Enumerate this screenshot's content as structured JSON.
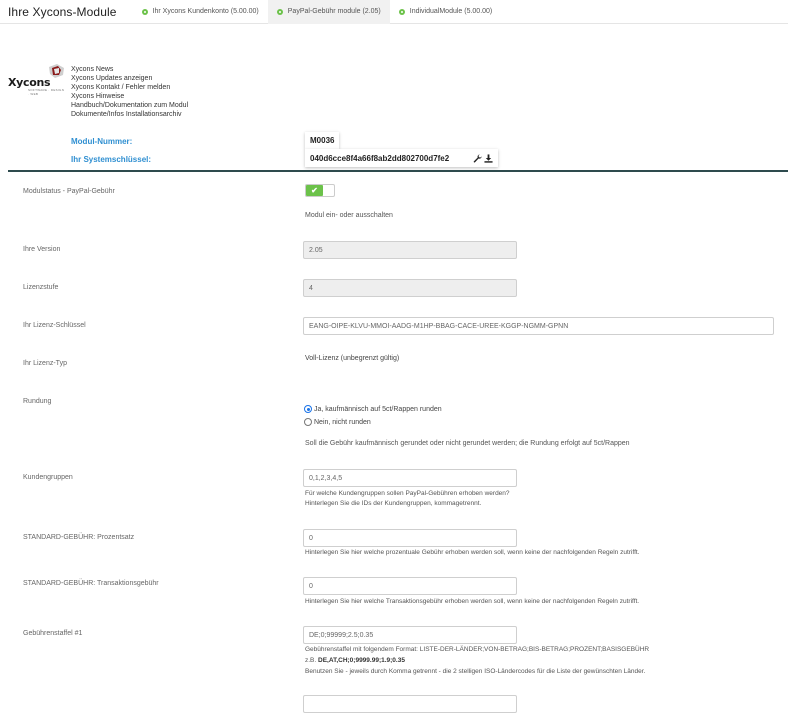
{
  "header": {
    "title": "Ihre Xycons-Module",
    "tabs": [
      {
        "label": "Ihr Xycons Kundenkonto (5.00.00)"
      },
      {
        "label": "PayPal-Gebühr module (2.05)"
      },
      {
        "label": "IndividualModule (5.00.00)"
      }
    ]
  },
  "logo": {
    "text": "Xycons",
    "subtext": "SOFTWARE · DESIGN · WEB"
  },
  "links": [
    "Xycons News",
    "Xycons Updates anzeigen",
    "Xycons Kontakt / Fehler melden",
    "Xycons Hinweise",
    "Handbuch/Dokumentation zum Modul",
    "Dokumente/Infos Installationsarchiv"
  ],
  "module": {
    "number_label": "Modul-Nummer:",
    "number_value": "M0036",
    "syskey_label": "Ihr Systemschlüssel:",
    "syskey_value": "040d6cce8f4a66f8ab2dd802700d7fe2"
  },
  "colors": {
    "accent": "#2f8fd1",
    "toggle_on": "#6cc24a",
    "divider": "#2e4b4e"
  },
  "settings": {
    "status": {
      "label": "Modulstatus - PayPal-Gebühr",
      "help": "Modul ein- oder ausschalten",
      "enabled": true,
      "check_glyph": "✔"
    },
    "version": {
      "label": "Ihre Version",
      "value": "2.05"
    },
    "level": {
      "label": "Lizenzstufe",
      "value": "4"
    },
    "license_key": {
      "label": "Ihr Lizenz-Schlüssel",
      "value": "EANG-OIPE-KLVU-MMOI-AADG-M1HP-BBAG-CACE-UREE-KGGP-NGMM-GPNN"
    },
    "license_type": {
      "label": "Ihr Lizenz-Typ",
      "value": "Voll-Lizenz (unbegrenzt gültig)"
    },
    "rounding": {
      "label": "Rundung",
      "option_yes": "Ja, kaufmännisch auf 5ct/Rappen runden",
      "option_no": "Nein, nicht runden",
      "selected": "yes",
      "help": "Soll die Gebühr kaufmännisch gerundet oder nicht gerundet werden; die Rundung erfolgt auf 5ct/Rappen"
    },
    "customer_groups": {
      "label": "Kundengruppen",
      "value": "0,1,2,3,4,5",
      "help1": "Für welche Kundengruppen sollen PayPal-Gebühren erhoben werden?",
      "help2": "Hinterlegen Sie die IDs der Kundengruppen, kommagetrennt."
    },
    "std_percent": {
      "label": "STANDARD-GEBÜHR: Prozentsatz",
      "value": "0",
      "help": "Hinterlegen Sie hier welche prozentuale Gebühr erhoben werden soll, wenn keine der nachfolgenden Regeln zutrifft."
    },
    "std_transaction": {
      "label": "STANDARD-GEBÜHR: Transaktionsgebühr",
      "value": "0",
      "help": "Hinterlegen Sie hier welche Transaktionsgebühr erhoben werden soll, wenn keine der nachfolgenden Regeln zutrifft."
    },
    "tier1": {
      "label": "Gebührenstaffel #1",
      "value": "DE;0;99999;2.5;0.35",
      "help1": "Gebührenstaffel mit folgendem Format: LISTE-DER-LÄNDER;VON-BETRAG;BIS-BETRAG;PROZENT;BASISGEBÜHR",
      "example_prefix": "z.B.",
      "example_value": "DE,AT,CH;0;9999.99;1.9;0.35",
      "help3": "Benutzen Sie - jeweils durch Komma getrennt - die 2 stelligen ISO-Ländercodes für die Liste der gewünschten Länder."
    }
  }
}
